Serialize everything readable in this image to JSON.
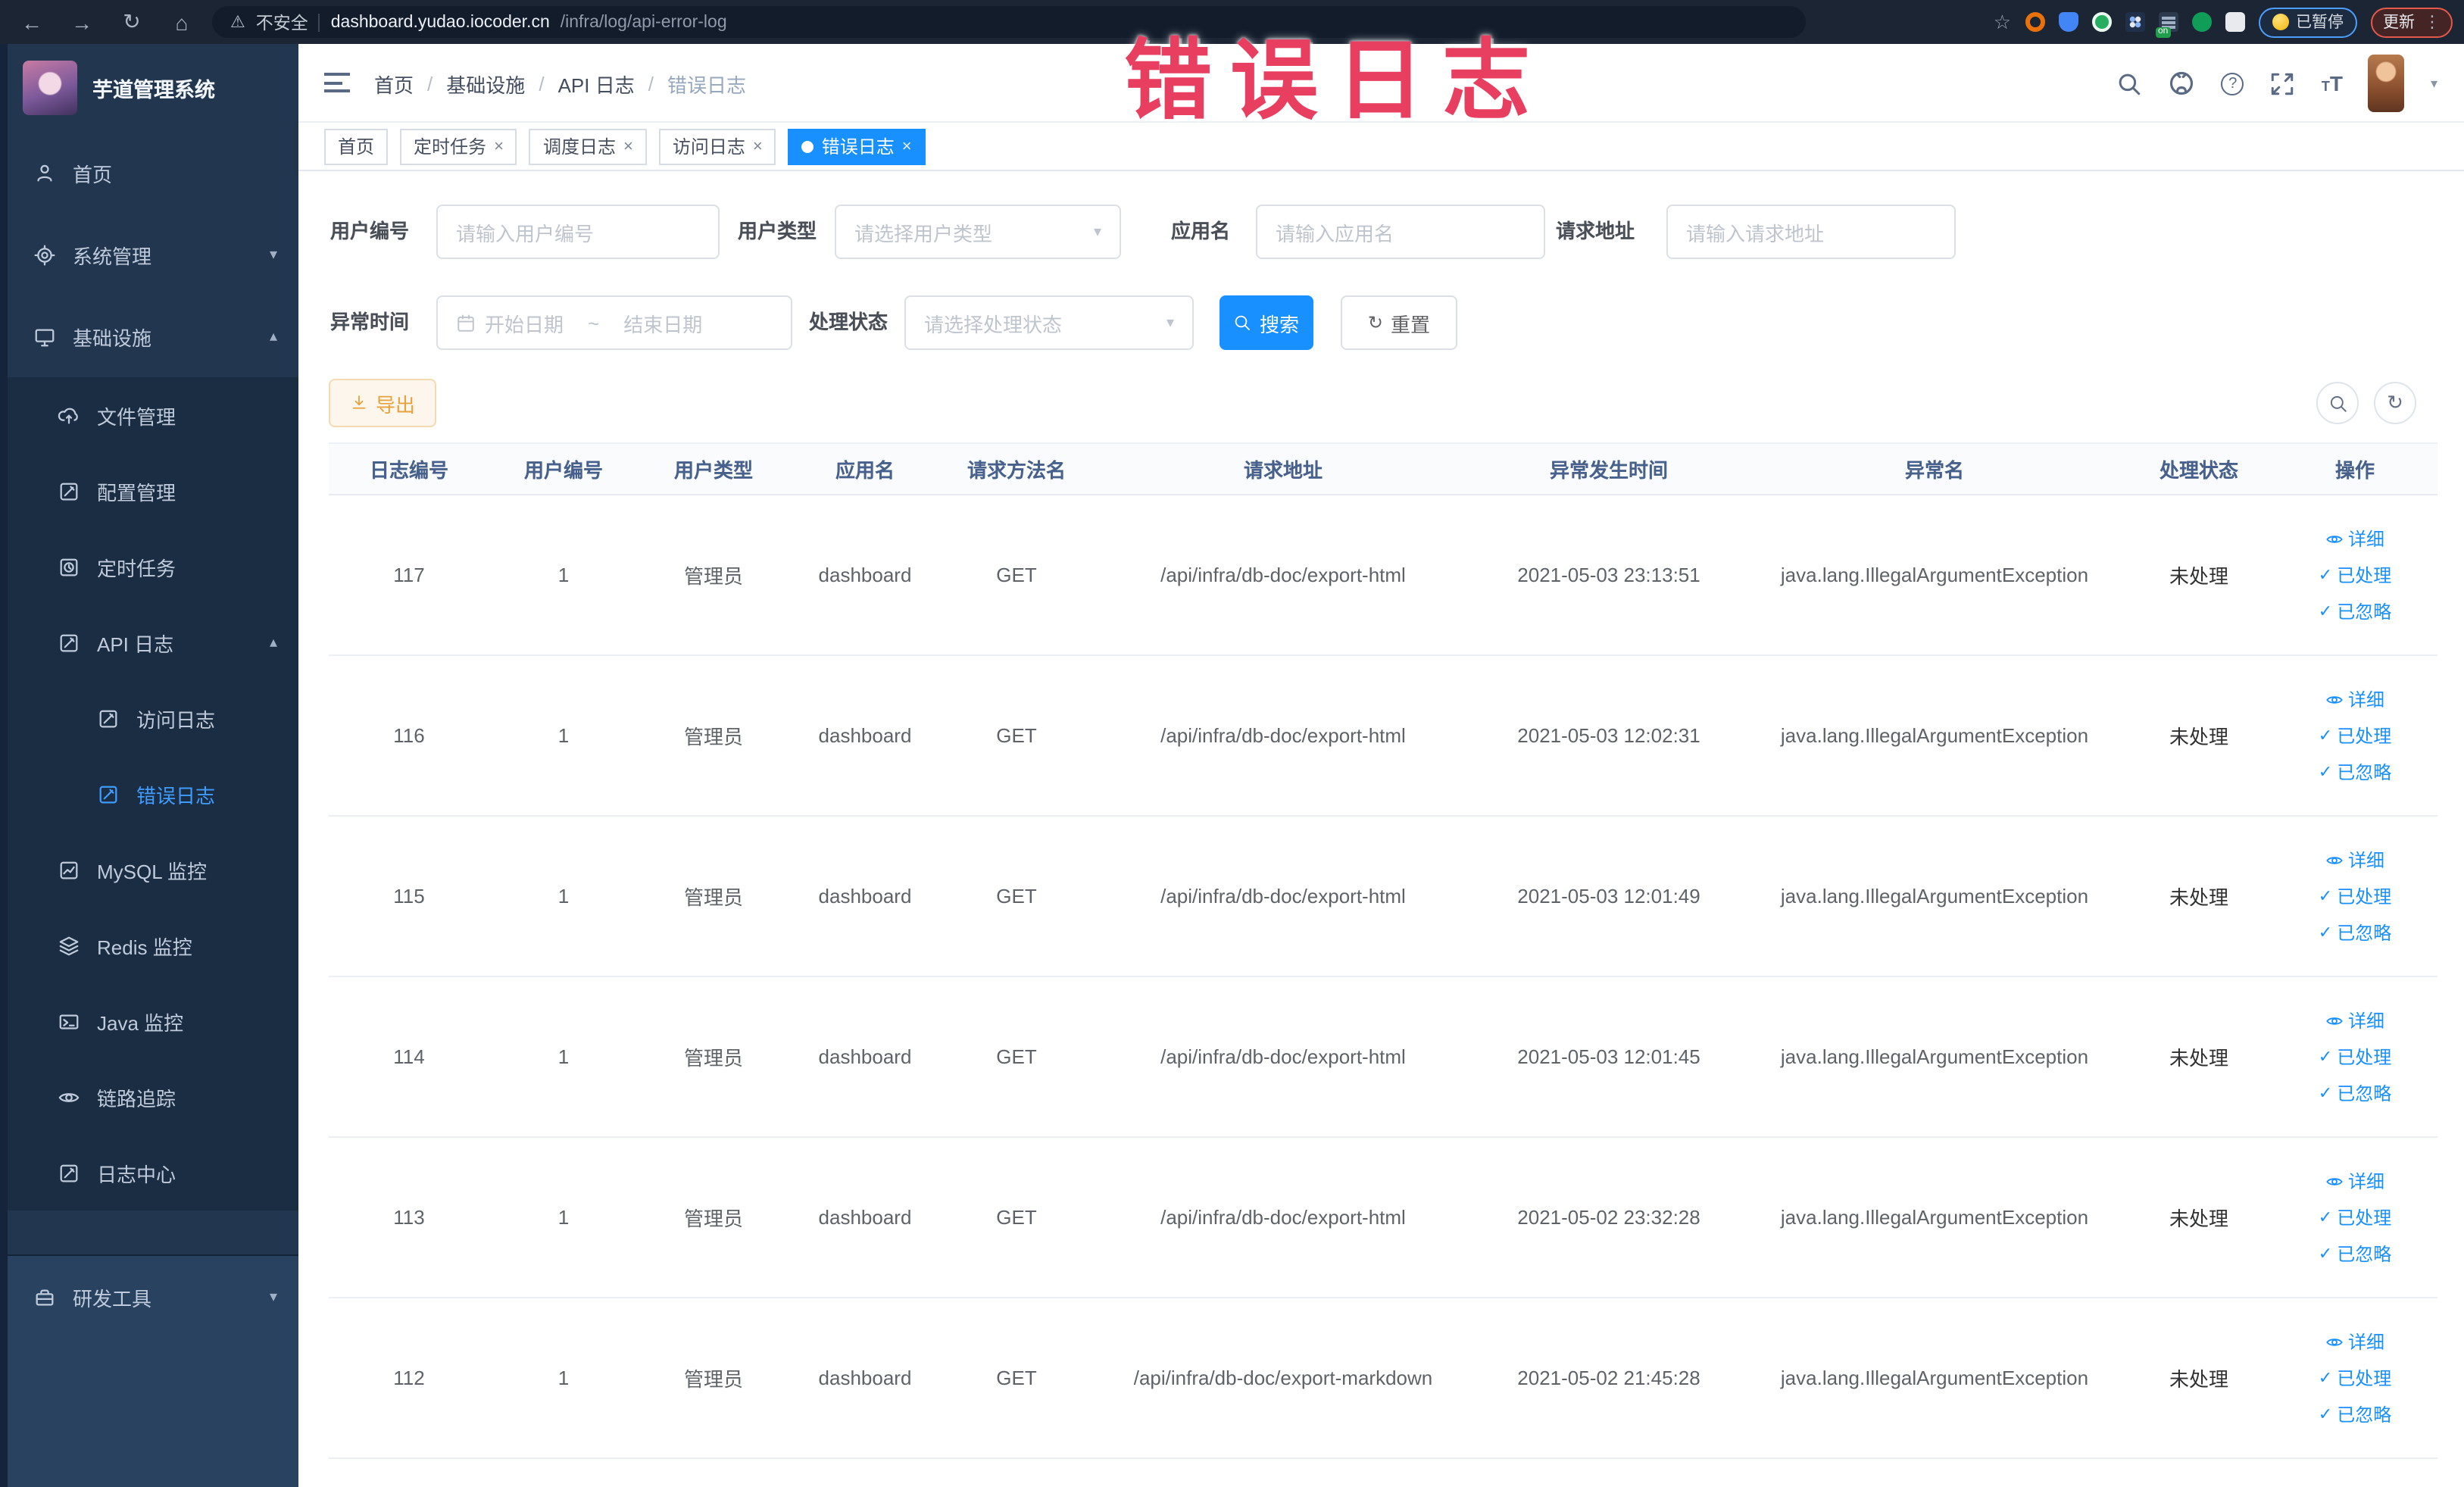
{
  "browser": {
    "security_label": "不安全",
    "url_domain": "dashboard.yudao.iocoder.cn",
    "url_path": "/infra/log/api-error-log",
    "extension_on_badge": "on",
    "paused_badge_label": "已暂停",
    "update_button_label": "更新"
  },
  "annotation": {
    "text": "错误日志",
    "color": "#e83e5f"
  },
  "sidebar": {
    "title": "芋道管理系统",
    "items": [
      {
        "label": "首页",
        "icon": "people-icon"
      },
      {
        "label": "系统管理",
        "icon": "gear-icon",
        "chevron": "down"
      },
      {
        "label": "基础设施",
        "icon": "monitor-icon",
        "chevron": "up"
      },
      {
        "label": "文件管理",
        "icon": "cloud-upload-icon"
      },
      {
        "label": "配置管理",
        "icon": "edit-square-icon"
      },
      {
        "label": "定时任务",
        "icon": "timer-icon"
      },
      {
        "label": "API 日志",
        "icon": "log-icon",
        "chevron": "up"
      },
      {
        "label": "访问日志",
        "icon": "log-icon"
      },
      {
        "label": "错误日志",
        "icon": "log-icon",
        "active": true
      },
      {
        "label": "MySQL 监控",
        "icon": "chart-icon"
      },
      {
        "label": "Redis 监控",
        "icon": "layers-icon"
      },
      {
        "label": "Java 监控",
        "icon": "console-icon"
      },
      {
        "label": "链路追踪",
        "icon": "eye-icon"
      },
      {
        "label": "日志中心",
        "icon": "log-icon"
      },
      {
        "label": "研发工具",
        "icon": "toolbox-icon",
        "chevron": "down"
      }
    ]
  },
  "breadcrumb": {
    "items": [
      "首页",
      "基础设施",
      "API 日志",
      "错误日志"
    ]
  },
  "tabs": [
    {
      "label": "首页"
    },
    {
      "label": "定时任务",
      "closable": true
    },
    {
      "label": "调度日志",
      "closable": true
    },
    {
      "label": "访问日志",
      "closable": true
    },
    {
      "label": "错误日志",
      "closable": true,
      "active": true
    }
  ],
  "filters": {
    "user_id": {
      "label": "用户编号",
      "placeholder": "请输入用户编号"
    },
    "user_type": {
      "label": "用户类型",
      "placeholder": "请选择用户类型"
    },
    "app_name": {
      "label": "应用名",
      "placeholder": "请输入应用名"
    },
    "request_url": {
      "label": "请求地址",
      "placeholder": "请输入请求地址"
    },
    "exception_time": {
      "label": "异常时间",
      "start_placeholder": "开始日期",
      "separator": "~",
      "end_placeholder": "结束日期"
    },
    "process_status": {
      "label": "处理状态",
      "placeholder": "请选择处理状态"
    },
    "search_button": "搜索",
    "reset_button": "重置"
  },
  "toolbar": {
    "export_button": "导出"
  },
  "table": {
    "columns": [
      "日志编号",
      "用户编号",
      "用户类型",
      "应用名",
      "请求方法名",
      "请求地址",
      "异常发生时间",
      "异常名",
      "处理状态",
      "操作"
    ],
    "actions": [
      "详细",
      "已处理",
      "已忽略"
    ],
    "rows": [
      {
        "id": "117",
        "user_id": "1",
        "user_type": "管理员",
        "app": "dashboard",
        "method": "GET",
        "url": "/api/infra/db-doc/export-html",
        "time": "2021-05-03 23:13:51",
        "exception": "java.lang.IllegalArgumentException",
        "status": "未处理"
      },
      {
        "id": "116",
        "user_id": "1",
        "user_type": "管理员",
        "app": "dashboard",
        "method": "GET",
        "url": "/api/infra/db-doc/export-html",
        "time": "2021-05-03 12:02:31",
        "exception": "java.lang.IllegalArgumentException",
        "status": "未处理"
      },
      {
        "id": "115",
        "user_id": "1",
        "user_type": "管理员",
        "app": "dashboard",
        "method": "GET",
        "url": "/api/infra/db-doc/export-html",
        "time": "2021-05-03 12:01:49",
        "exception": "java.lang.IllegalArgumentException",
        "status": "未处理"
      },
      {
        "id": "114",
        "user_id": "1",
        "user_type": "管理员",
        "app": "dashboard",
        "method": "GET",
        "url": "/api/infra/db-doc/export-html",
        "time": "2021-05-03 12:01:45",
        "exception": "java.lang.IllegalArgumentException",
        "status": "未处理"
      },
      {
        "id": "113",
        "user_id": "1",
        "user_type": "管理员",
        "app": "dashboard",
        "method": "GET",
        "url": "/api/infra/db-doc/export-html",
        "time": "2021-05-02 23:32:28",
        "exception": "java.lang.IllegalArgumentException",
        "status": "未处理"
      },
      {
        "id": "112",
        "user_id": "1",
        "user_type": "管理员",
        "app": "dashboard",
        "method": "GET",
        "url": "/api/infra/db-doc/export-markdown",
        "time": "2021-05-02 21:45:28",
        "exception": "java.lang.IllegalArgumentException",
        "status": "未处理"
      }
    ]
  },
  "colors": {
    "accent": "#1890ff",
    "warning": "#e6a23c",
    "sidebar_bg": "#22374f",
    "submenu_bg": "#1b2d42",
    "annotation": "#e83e5f"
  }
}
